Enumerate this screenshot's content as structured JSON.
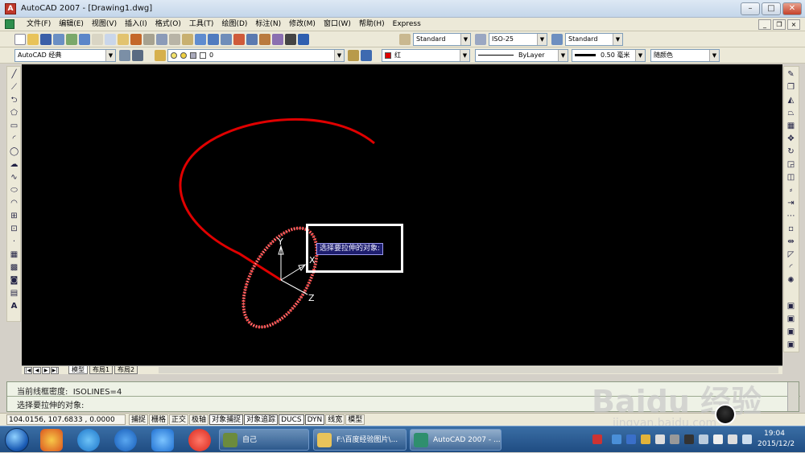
{
  "window": {
    "title": "AutoCAD 2007 - [Drawing1.dwg]",
    "minimize": "–",
    "maximize": "□",
    "close": "✕"
  },
  "menu": {
    "items": [
      "文件(F)",
      "编辑(E)",
      "视图(V)",
      "插入(I)",
      "格式(O)",
      "工具(T)",
      "绘图(D)",
      "标注(N)",
      "修改(M)",
      "窗口(W)",
      "帮助(H)",
      "Express"
    ],
    "mdi_minimize": "_",
    "mdi_restore": "❐",
    "mdi_close": "×"
  },
  "styles": {
    "text_style": "Standard",
    "dim_style": "ISO-25",
    "table_style": "Standard"
  },
  "properties": {
    "workspace": "AutoCAD 经典",
    "layer": "0",
    "color": "红",
    "color_hex": "#e00000",
    "linetype": "ByLayer",
    "lineweight": "0.50 毫米",
    "plot_style": "随颜色"
  },
  "canvas": {
    "axis_y": "Y",
    "axis_x": "X",
    "axis_z": "Z",
    "tooltip": "选择要拉伸的对象:"
  },
  "layout_tabs": [
    "模型",
    "布局1",
    "布局2"
  ],
  "command": {
    "line1": "当前线框密度:  ISOLINES=4",
    "line2": "选择要拉伸的对象:"
  },
  "status": {
    "coords": "104.0156,  107.6833 , 0.0000",
    "toggles": [
      "捕捉",
      "栅格",
      "正交",
      "极轴",
      "对象捕捉",
      "对象追踪",
      "DUCS",
      "DYN",
      "线宽",
      "模型"
    ]
  },
  "taskbar": {
    "tasks": [
      "自己",
      "F:\\百度经验图片\\...",
      "AutoCAD 2007 - ..."
    ],
    "time": "19:04",
    "date": "2015/12/2"
  },
  "watermark": {
    "logo": "Baidu 经验",
    "url": "jingyan.baidu.com"
  }
}
